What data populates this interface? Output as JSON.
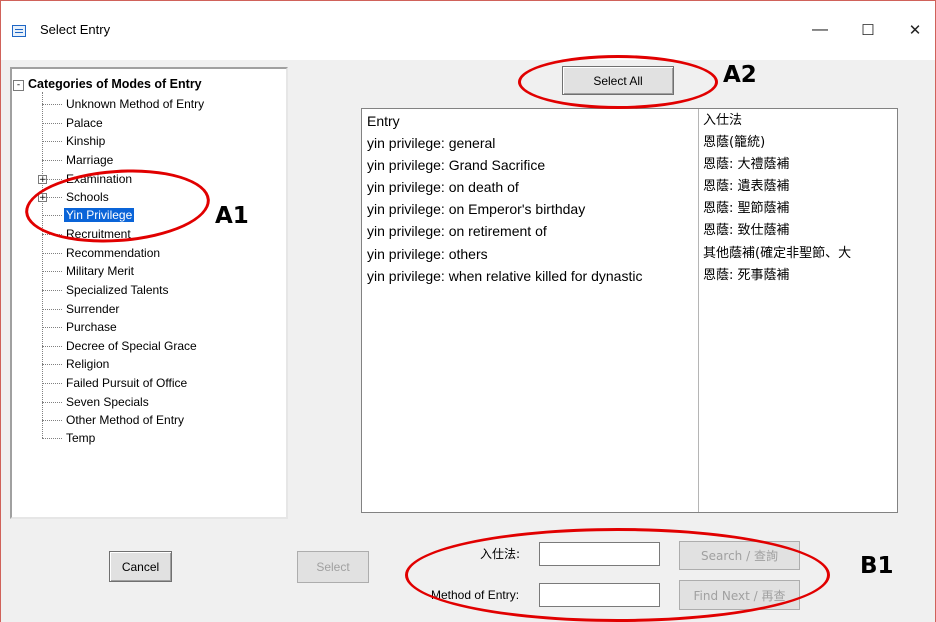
{
  "window": {
    "title": "Select Entry",
    "controls": {
      "minimize": "—",
      "maximize": "☐",
      "close": "✕"
    }
  },
  "tree": {
    "root_label": "Categories of Modes of Entry",
    "root_expander": "-",
    "items": [
      {
        "label": "Unknown Method of Entry"
      },
      {
        "label": "Palace"
      },
      {
        "label": "Kinship"
      },
      {
        "label": "Marriage"
      },
      {
        "label": "Examination",
        "expander": "+"
      },
      {
        "label": "Schools",
        "expander": "+"
      },
      {
        "label": "Yin Privilege",
        "selected": true
      },
      {
        "label": "Recruitment"
      },
      {
        "label": "Recommendation"
      },
      {
        "label": "Military Merit"
      },
      {
        "label": "Specialized Talents"
      },
      {
        "label": "Surrender"
      },
      {
        "label": "Purchase"
      },
      {
        "label": "Decree of Special Grace"
      },
      {
        "label": "Religion"
      },
      {
        "label": "Failed Pursuit of Office"
      },
      {
        "label": "Seven Specials"
      },
      {
        "label": "Other Method of Entry"
      },
      {
        "label": "Temp"
      }
    ]
  },
  "select_all_label": "Select All",
  "entry_list": {
    "columns": [
      "Entry",
      "入仕法"
    ],
    "rows": [
      [
        "yin privilege: general",
        "恩蔭(籠統)"
      ],
      [
        "yin privilege: Grand Sacrifice",
        "恩蔭: 大禮蔭補"
      ],
      [
        "yin privilege: on death of",
        "恩蔭: 遺表蔭補"
      ],
      [
        "yin privilege: on Emperor's birthday",
        "恩蔭: 聖節蔭補"
      ],
      [
        "yin privilege: on retirement of",
        "恩蔭: 致仕蔭補"
      ],
      [
        "yin privilege: others",
        "其他蔭補(確定非聖節、大"
      ],
      [
        "yin privilege: when relative killed for dynastic",
        "恩蔭: 死事蔭補"
      ]
    ]
  },
  "bottom": {
    "cancel_label": "Cancel",
    "select_label": "Select",
    "zh_field_label": "入仕法:",
    "zh_field_value": "",
    "en_field_label": "Method of Entry:",
    "en_field_value": "",
    "search_label": "Search / 查詢",
    "find_next_label": "Find Next / 再查"
  },
  "annotations": {
    "a1": "A1",
    "a2": "A2",
    "b1": "B1",
    "color": "#e10000"
  }
}
